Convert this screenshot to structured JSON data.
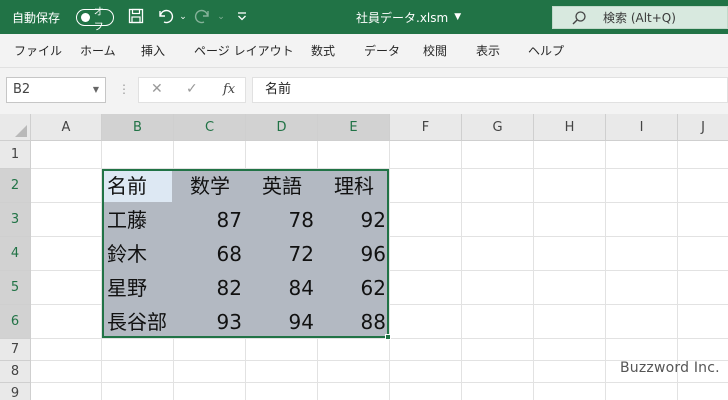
{
  "titlebar": {
    "autosave_label": "自動保存",
    "autosave_state": "オフ",
    "file_title": "社員データ.xlsm",
    "search_label": "検索 (Alt+Q)"
  },
  "menu": {
    "items": [
      "ファイル",
      "ホーム",
      "挿入",
      "ページ レイアウト",
      "数式",
      "データ",
      "校閲",
      "表示",
      "ヘルプ"
    ]
  },
  "formula_bar": {
    "name_box": "B2",
    "fx_label": "fx",
    "content": "名前"
  },
  "grid": {
    "columns": [
      "A",
      "B",
      "C",
      "D",
      "E",
      "F",
      "G",
      "H",
      "I",
      "J"
    ],
    "rows": [
      "1",
      "2",
      "3",
      "4",
      "5",
      "6",
      "7",
      "8",
      "9"
    ],
    "headers": [
      "名前",
      "数学",
      "英語",
      "理科"
    ],
    "data": [
      [
        "工藤",
        "87",
        "78",
        "92"
      ],
      [
        "鈴木",
        "68",
        "72",
        "96"
      ],
      [
        "星野",
        "82",
        "84",
        "62"
      ],
      [
        "長谷部",
        "93",
        "94",
        "88"
      ]
    ]
  },
  "colors": {
    "accent": "#217346",
    "selection": "#b3b9c2",
    "active_cell": "#dde8f3"
  },
  "watermark": "Buzzword Inc."
}
